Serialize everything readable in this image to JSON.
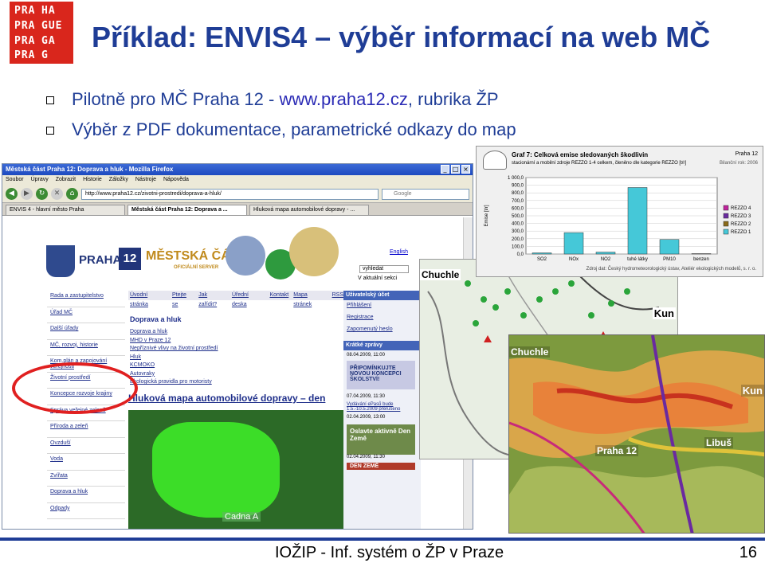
{
  "logo": {
    "lines": [
      "PRA",
      "HA",
      "PRA",
      "GUE",
      "PRA",
      "GA",
      "PRA",
      "G"
    ]
  },
  "slide": {
    "title": "Příklad: ENVIS4 – výběr informací na web MČ",
    "bullet1_pre": "Pilotně pro MČ Praha 12 - ",
    "bullet1_link": "www.praha12.cz",
    "bullet1_post": ", rubrika ŽP",
    "bullet2": "Výběr z PDF dokumentace, parametrické odkazy do map"
  },
  "browser": {
    "window_title": "Městská část Praha 12: Doprava a hluk - Mozilla Firefox",
    "menu": [
      "Soubor",
      "Úpravy",
      "Zobrazit",
      "Historie",
      "Záložky",
      "Nástroje",
      "Nápověda"
    ],
    "url": "http://www.praha12.cz/zivotni-prostredi/doprava-a-hluk/",
    "search_placeholder": "Google",
    "tabs": [
      "ENVIS 4 - hlavní město Praha",
      "Městská část Praha 12: Doprava a ...",
      "Hluková mapa automobilové dopravy - ..."
    ]
  },
  "site": {
    "praha": "PRAHA",
    "twelve": "12",
    "mestska_cast": "MĚSTSKÁ ČÁST",
    "oficialni": "OFICIÁLNÍ SERVER",
    "english": "English",
    "search_value": "vyhledat",
    "aktualni": "V aktuální sekci",
    "left_nav": [
      "Rada a zastupitelstvo",
      "Úřad MČ",
      "Další úřady",
      "MČ, rozvoj, historie",
      "Kom.plán a zapojování veřejnosti",
      "Životní prostředí",
      "Koncepce rozvoje krajiny",
      "Správa veřejné zeleně",
      "Příroda a zeleň",
      "Ovzduší",
      "Voda",
      "Zvířata",
      "Doprava a hluk",
      "Odpady"
    ],
    "top_nav": [
      "Úvodní stránka",
      "Ptejte se",
      "Jak zařídit?",
      "Úřední deska",
      "Kontakt",
      "Mapa stránek",
      "RSS"
    ],
    "content_title": "Doprava a hluk",
    "content_links": [
      "Doprava a hluk",
      "MHD v Praze 12",
      "Nepříznivé vlivy na životní prostředí",
      "Hluk",
      "KCMOKO",
      "Autovraky",
      "Ekologická pravidla pro motoristy"
    ],
    "hluk_title": "Hluková mapa automobilové dopravy – den",
    "map_label": "Cadna A",
    "user_head": "Uživatelský účet",
    "user_links": [
      "Přihlášení",
      "Registrace",
      "Zapomenutý heslo"
    ],
    "news_head": "Krátké zprávy",
    "news1_date": "08.04.2009, 11:00",
    "news1_box": "PŘIPOMÍNKUJTE NOVOU KONCEPCI ŠKOLSTVÍ!",
    "news2_date": "07.04.2009, 11:30",
    "news2_text": "Vydávání ePasů bude 1.5.-10.5.2009 přerušeno",
    "news3_date": "02.04.2009, 13:00",
    "oslavte": "Oslavte aktivně Den Země",
    "news4_date": "02.04.2009, 11:30",
    "den_zeme": "DEN ZEMĚ"
  },
  "chart_data": {
    "type": "bar",
    "title": "Graf 7: Celková emise sledovaných škodlivin",
    "subtitle": "stacionární a mobilní zdroje REZZO 1-4 celkem, členěno dle kategorie REZZO [t/r]",
    "place": "Praha 12",
    "year_label": "Bilanční rok: 2006",
    "ylabel": "Emise [t/r]",
    "source": "Zdroj dat: Český hydrometeorologický ústav, Ateliér ekologických modelů, s. r. o.",
    "categories": [
      "SO2",
      "NOx",
      "NO2",
      "tuhé látky",
      "PM10",
      "benzen"
    ],
    "yticks": [
      "1 000,0",
      "900,0",
      "800,0",
      "700,0",
      "600,0",
      "500,0",
      "400,0",
      "300,0",
      "200,0",
      "100,0",
      "0,0"
    ],
    "ylim": [
      0,
      1000
    ],
    "series": [
      {
        "name": "REZZO 4",
        "color": "#c0229c",
        "values": [
          0,
          0,
          0,
          0,
          0,
          0
        ]
      },
      {
        "name": "REZZO 3",
        "color": "#6a2aa0",
        "values": [
          0,
          0,
          0,
          0,
          0,
          0
        ]
      },
      {
        "name": "REZZO 2",
        "color": "#8a6a1a",
        "values": [
          0,
          0,
          0,
          0,
          0,
          0
        ]
      },
      {
        "name": "REZZO 1",
        "color": "#45c8d8",
        "values": [
          15,
          280,
          25,
          870,
          190,
          5
        ]
      }
    ]
  },
  "maps": {
    "chuchle": "Chuchle",
    "kunratice": "Kun",
    "libus": "Libuš",
    "praha12": "Praha 12"
  },
  "footer": {
    "text": "IOŽIP - Inf. systém o ŽP v Praze",
    "page": "16"
  }
}
